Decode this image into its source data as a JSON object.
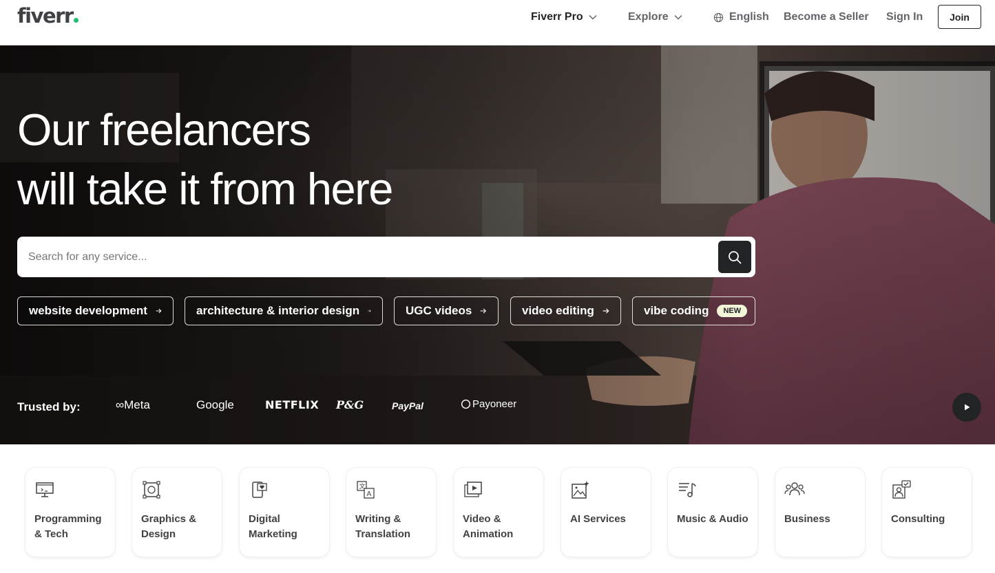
{
  "header": {
    "logo_text": "fiverr",
    "nav": {
      "pro_label": "Fiverr Pro",
      "explore_label": "Explore",
      "language_label": "English",
      "seller_label": "Become a Seller",
      "signin_label": "Sign In",
      "join_label": "Join"
    }
  },
  "hero": {
    "title_line1": "Our freelancers",
    "title_line2": "will take it from here",
    "search": {
      "placeholder": "Search for any service..."
    },
    "chips": [
      {
        "label": "website development"
      },
      {
        "label": "architecture & interior design"
      },
      {
        "label": "UGC videos"
      },
      {
        "label": "video editing"
      },
      {
        "label": "vibe coding",
        "badge": "NEW"
      }
    ],
    "trusted_label": "Trusted by:",
    "brands": [
      "Meta",
      "Google",
      "NETFLIX",
      "P&G",
      "PayPal",
      "Payoneer"
    ]
  },
  "categories": [
    {
      "label": "Programming & Tech",
      "icon": "monitor-code-icon"
    },
    {
      "label": "Graphics & Design",
      "icon": "design-frame-icon"
    },
    {
      "label": "Digital Marketing",
      "icon": "phone-heart-icon"
    },
    {
      "label": "Writing & Translation",
      "icon": "translate-icon"
    },
    {
      "label": "Video & Animation",
      "icon": "video-play-icon"
    },
    {
      "label": "AI Services",
      "icon": "ai-image-icon"
    },
    {
      "label": "Music & Audio",
      "icon": "music-list-icon"
    },
    {
      "label": "Business",
      "icon": "people-icon"
    },
    {
      "label": "Consulting",
      "icon": "consulting-icon"
    }
  ],
  "colors": {
    "brand_green": "#1dbf73",
    "dark": "#222325",
    "muted": "#62646a",
    "new_badge": "#f3f5d8"
  }
}
